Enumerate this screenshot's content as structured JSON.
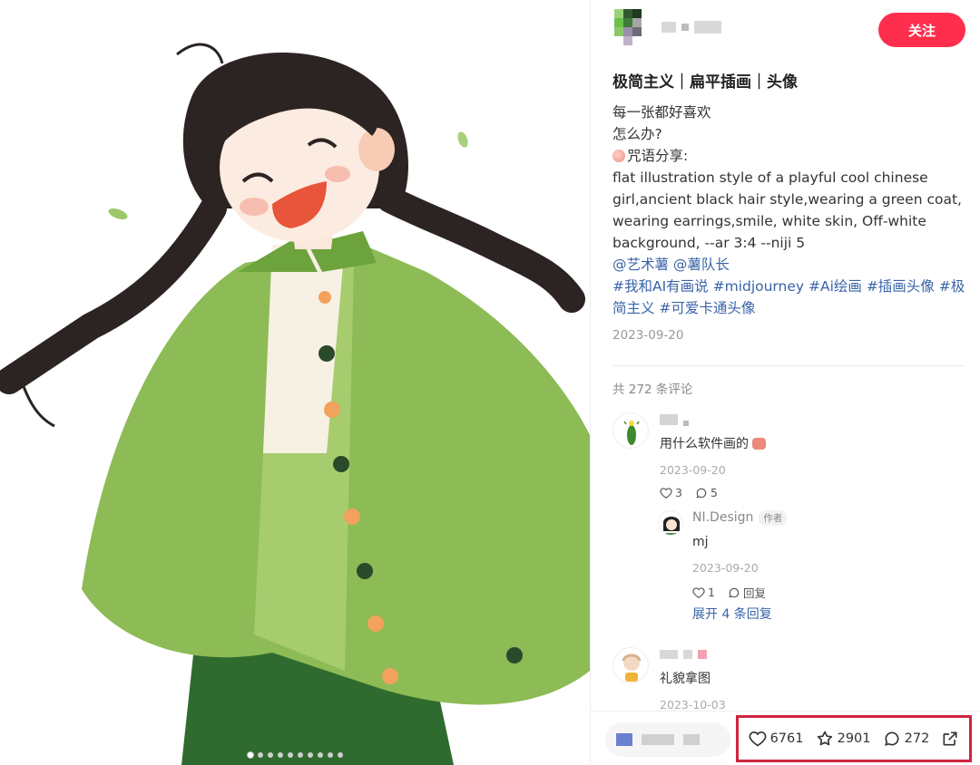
{
  "post": {
    "title": "极简主义｜扁平插画｜头像",
    "lines": [
      "每一张都好喜欢",
      "怎么办?"
    ],
    "prompt_label": "咒语分享:",
    "prompt_text": "flat illustration style of a playful cool chinese girl,ancient black hair style,wearing a green coat, wearing earrings,smile, white skin, Off-white background, --ar 3:4 --niji 5",
    "mentions": "@艺术薯 @薯队长",
    "hashtags": "#我和AI有画说 #midjourney #Ai绘画 #插画头像 #极简主义 #可爱卡通头像",
    "date": "2023-09-20"
  },
  "header": {
    "follow_label": "关注"
  },
  "comments_total": "共 272 条评论",
  "comments": [
    {
      "text": "用什么软件画的",
      "date": "2023-09-20",
      "likes": "3",
      "replies": "5"
    },
    {
      "name": "NI.Design",
      "badge": "作者",
      "text": "mj",
      "date": "2023-09-20",
      "likes": "1",
      "reply_label": "回复"
    },
    {
      "expand": "展开 4 条回复"
    },
    {
      "text": "礼貌拿图",
      "date": "2023-10-03"
    }
  ],
  "bottom_bar": {
    "likes": "6761",
    "collects": "2901",
    "comments": "272"
  },
  "carousel": {
    "count": 10,
    "active": 0
  },
  "colors": {
    "accent": "#ff2e4d",
    "link": "#3a64a8",
    "highlight_box": "#d0243f",
    "coat": "#8dbb55"
  },
  "icons": [
    "heart-icon",
    "star-icon",
    "comment-icon",
    "share-icon",
    "chat-icon"
  ]
}
